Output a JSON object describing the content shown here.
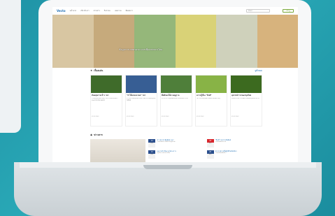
{
  "nav": {
    "logo": "Vecto",
    "menu": [
      "หน้าแรก",
      "เกี่ยวกับเรา",
      "ข่าวสาร",
      "กิจกรรม",
      "บทความ",
      "ติดต่อเรา"
    ],
    "search_placeholder": "ค้นหา",
    "button": "เข้าสู่"
  },
  "hero": {
    "title": "ข้อมูลการเกษตรครบวงจรเพื่อเกษตรกรไทย",
    "colors": [
      "#d8c6a2",
      "#c6aa7c",
      "#95b77a",
      "#d9d277",
      "#cfd1bb",
      "#d7b37d"
    ]
  },
  "featured": {
    "heading": "เรื่องเด่น",
    "more": "ดูทั้งหมด",
    "cards": [
      {
        "title": "ทันตสุขภาพ ข้าว ฯลฯ",
        "desc": "รายละเอียดเนื้อหาบทความการเกษตรพร้อมคำแนะนำสำหรับเกษตรกร",
        "meta": "01/01/2563",
        "color": "#3f6b2a"
      },
      {
        "title": "\"ป่าไม้แห่งอนาคต\" ฯลฯ",
        "desc": "ข่าวกิจกรรมอนุรักษ์ป่าและการมีส่วนร่วมของชุมชนในพื้นที่",
        "meta": "01/01/2563",
        "color": "#375e94"
      },
      {
        "title": "พืชผักผลไม้ตามฤดูกาล",
        "desc": "แนวทางการปลูกพืชผักหมุนเวียนเพื่อเพิ่มรายได้",
        "meta": "01/01/2563",
        "color": "#4f7f3a"
      },
      {
        "title": "ความรู้เรื่อง \"ดินดี\"",
        "desc": "วิธีการปรับปรุงคุณภาพดินด้วยอินทรียวัตถุ",
        "meta": "01/01/2563",
        "color": "#88b346"
      },
      {
        "title": "อุปกรณ์การเกษตรยุคใหม่",
        "desc": "เครื่องจักรกลการเกษตรช่วยลดต้นทุนและแรงงาน",
        "meta": "01/01/2563",
        "color": "#3c6a1f"
      }
    ]
  },
  "news": {
    "heading": "ข่าวสาร",
    "left": [
      {
        "day": "12",
        "month": "ม.ค.",
        "title": "ข่าวประชาสัมพันธ์ ฯลฯ",
        "caption": "รายละเอียดข่าวสั้นสำหรับผู้เข้าชม"
      },
      {
        "day": "15",
        "month": "ม.ค.",
        "title": "ผลการดำเนินงานโครงการ",
        "caption": "สรุปกิจกรรมประจำเดือน"
      }
    ],
    "right": [
      {
        "day": "18",
        "month": "ม.ค.",
        "title": "\"ดินดี\" ประชาสัมพันธ์",
        "caption": "รายละเอียดกิจกรรม"
      },
      {
        "day": "20",
        "month": "ม.ค.",
        "title": "ประกาศรายชื่อผู้ได้รับคัดเลือก",
        "caption": "รายละเอียดเพิ่มเติม"
      }
    ]
  }
}
